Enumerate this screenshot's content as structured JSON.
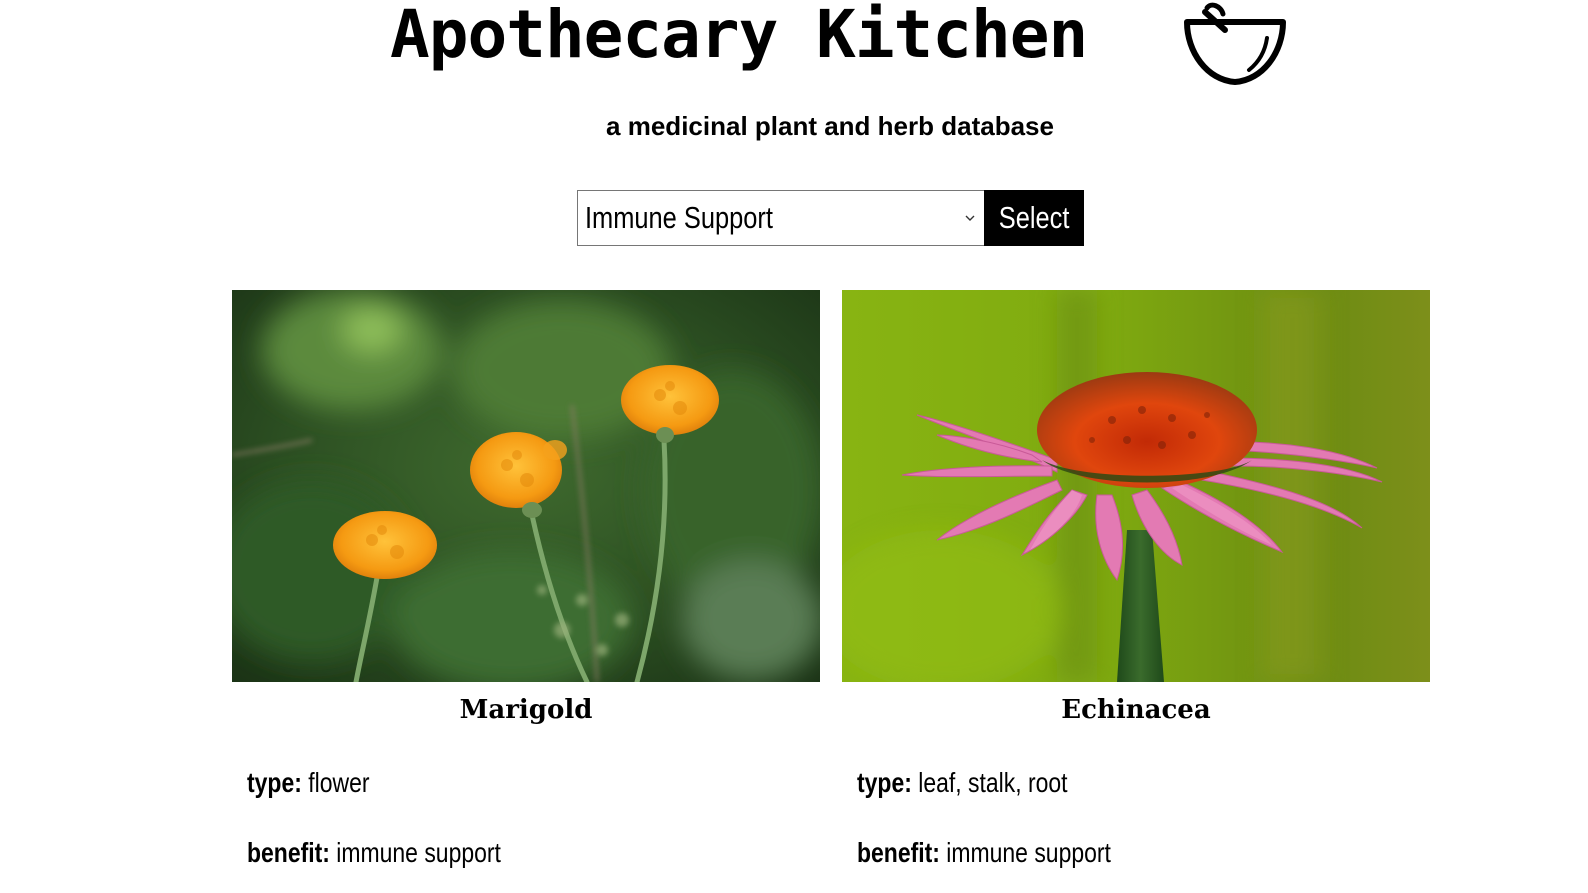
{
  "header": {
    "title": "Apothecary Kitchen",
    "icon": "mortar-bowl-icon",
    "subtitle": "a medicinal plant and herb database"
  },
  "filter": {
    "selected_value": "Immune Support",
    "button_label": "Select"
  },
  "plants": [
    {
      "name": "Marigold",
      "image": "marigold-photo",
      "type_label": "type:",
      "type_value": "flower",
      "benefit_label": "benefit:",
      "benefit_value": "immune support"
    },
    {
      "name": "Echinacea",
      "image": "echinacea-photo",
      "type_label": "type:",
      "type_value": "leaf, stalk, root",
      "benefit_label": "benefit:",
      "benefit_value": "immune support"
    }
  ],
  "colors": {
    "button_bg": "#000000",
    "button_text": "#ffffff"
  }
}
